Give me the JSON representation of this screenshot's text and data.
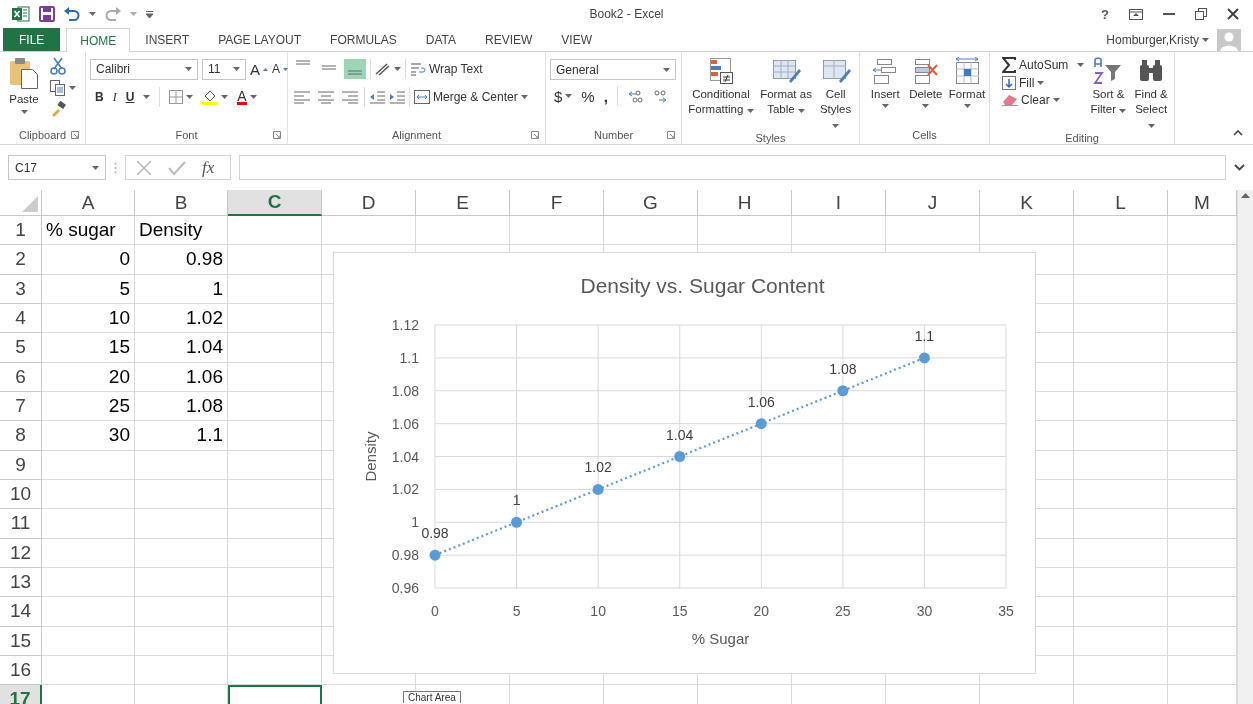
{
  "title_bar": {
    "title": "Book2 - Excel",
    "help": "?"
  },
  "tabs": [
    {
      "label": "FILE",
      "kind": "file",
      "selected": false
    },
    {
      "label": "HOME",
      "kind": "tab",
      "selected": true
    },
    {
      "label": "INSERT",
      "kind": "tab",
      "selected": false
    },
    {
      "label": "PAGE LAYOUT",
      "kind": "tab",
      "selected": false
    },
    {
      "label": "FORMULAS",
      "kind": "tab",
      "selected": false
    },
    {
      "label": "DATA",
      "kind": "tab",
      "selected": false
    },
    {
      "label": "REVIEW",
      "kind": "tab",
      "selected": false
    },
    {
      "label": "VIEW",
      "kind": "tab",
      "selected": false
    }
  ],
  "account": {
    "name": "Homburger,Kristy"
  },
  "ribbon": {
    "clipboard": {
      "label": "Clipboard",
      "paste": "Paste"
    },
    "font": {
      "label": "Font",
      "font_name": "Calibri",
      "font_size": "11",
      "grow": "A",
      "shrink": "A",
      "bold": "B",
      "italic": "I",
      "underline": "U",
      "font_color": "A"
    },
    "alignment": {
      "label": "Alignment",
      "wrap_text": "Wrap Text",
      "merge_center": "Merge & Center",
      "vertical_align": [
        {
          "selected": false
        },
        {
          "selected": false
        },
        {
          "selected": true
        }
      ]
    },
    "number": {
      "label": "Number",
      "format": "General",
      "currency": "$",
      "percent": "%",
      "comma": ","
    },
    "styles": {
      "label": "Styles",
      "buttons": [
        {
          "label": "Conditional Formatting"
        },
        {
          "label": "Format as Table"
        },
        {
          "label": "Cell Styles"
        }
      ]
    },
    "cells": {
      "label": "Cells",
      "buttons": [
        {
          "label": "Insert"
        },
        {
          "label": "Delete"
        },
        {
          "label": "Format"
        }
      ]
    },
    "editing": {
      "label": "Editing",
      "autosum": "AutoSum",
      "fill": "Fill",
      "clear": "Clear",
      "sort_filter": "Sort & Filter",
      "find_select": "Find & Select"
    }
  },
  "formula_bar": {
    "name_box": "C17",
    "fx": "fx"
  },
  "sheet": {
    "columns": [
      {
        "label": "A",
        "selected": false
      },
      {
        "label": "B",
        "selected": false
      },
      {
        "label": "C",
        "selected": true
      },
      {
        "label": "D",
        "selected": false
      },
      {
        "label": "E",
        "selected": false
      },
      {
        "label": "F",
        "selected": false
      },
      {
        "label": "G",
        "selected": false
      },
      {
        "label": "H",
        "selected": false
      },
      {
        "label": "I",
        "selected": false
      },
      {
        "label": "J",
        "selected": false
      },
      {
        "label": "K",
        "selected": false
      },
      {
        "label": "L",
        "selected": false
      },
      {
        "label": "M",
        "selected": false
      }
    ],
    "rows": [
      {
        "label": "1",
        "selected": false,
        "cells": [
          {
            "text": "% sugar",
            "kind": "text"
          },
          {
            "text": "Density",
            "kind": "text"
          }
        ]
      },
      {
        "label": "2",
        "selected": false,
        "cells": [
          {
            "text": "0",
            "kind": "number"
          },
          {
            "text": "0.98",
            "kind": "number"
          }
        ]
      },
      {
        "label": "3",
        "selected": false,
        "cells": [
          {
            "text": "5",
            "kind": "number"
          },
          {
            "text": "1",
            "kind": "number"
          }
        ]
      },
      {
        "label": "4",
        "selected": false,
        "cells": [
          {
            "text": "10",
            "kind": "number"
          },
          {
            "text": "1.02",
            "kind": "number"
          }
        ]
      },
      {
        "label": "5",
        "selected": false,
        "cells": [
          {
            "text": "15",
            "kind": "number"
          },
          {
            "text": "1.04",
            "kind": "number"
          }
        ]
      },
      {
        "label": "6",
        "selected": false,
        "cells": [
          {
            "text": "20",
            "kind": "number"
          },
          {
            "text": "1.06",
            "kind": "number"
          }
        ]
      },
      {
        "label": "7",
        "selected": false,
        "cells": [
          {
            "text": "25",
            "kind": "number"
          },
          {
            "text": "1.08",
            "kind": "number"
          }
        ]
      },
      {
        "label": "8",
        "selected": false,
        "cells": [
          {
            "text": "30",
            "kind": "number"
          },
          {
            "text": "1.1",
            "kind": "number"
          }
        ]
      },
      {
        "label": "9",
        "selected": false
      },
      {
        "label": "10",
        "selected": false
      },
      {
        "label": "11",
        "selected": false
      },
      {
        "label": "12",
        "selected": false
      },
      {
        "label": "13",
        "selected": false
      },
      {
        "label": "14",
        "selected": false
      },
      {
        "label": "15",
        "selected": false
      },
      {
        "label": "16",
        "selected": false
      },
      {
        "label": "17",
        "selected": true
      }
    ]
  },
  "chart": {
    "chart_data": {
      "type": "scatter",
      "title": "Density vs. Sugar Content",
      "xlabel": "% Sugar",
      "ylabel": "Density",
      "x": [
        0,
        5,
        10,
        15,
        20,
        25,
        30
      ],
      "series": [
        {
          "color": "#5b9bd5",
          "values": [
            0.98,
            1,
            1.02,
            1.04,
            1.06,
            1.08,
            1.1
          ]
        }
      ],
      "xlim": [
        0,
        35
      ],
      "ylim": [
        0.96,
        1.12
      ],
      "xticks": [
        0,
        5,
        10,
        15,
        20,
        25,
        30,
        35
      ],
      "yticks": [
        0.96,
        0.98,
        1,
        1.02,
        1.04,
        1.06,
        1.08,
        1.1,
        1.12
      ],
      "data_labels": true,
      "grid": true
    },
    "tooltip": "Chart Area"
  }
}
